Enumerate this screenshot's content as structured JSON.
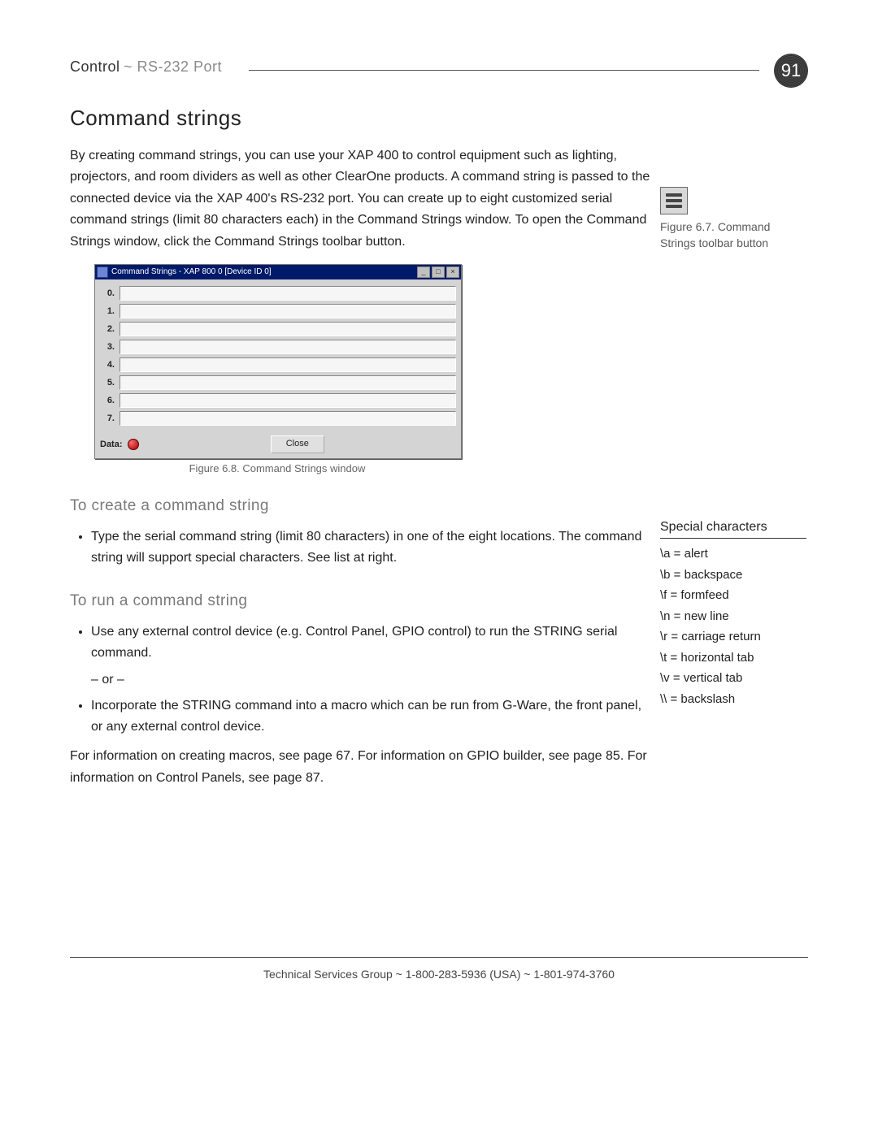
{
  "header": {
    "crumb1": "Control",
    "sep": "~",
    "crumb2": "RS-232 Port",
    "page_number": "91"
  },
  "main": {
    "h1": "Command strings",
    "intro": "By creating command strings, you can use your XAP 400 to control equipment such as lighting, projectors, and room dividers as well as other ClearOne products. A command string is passed to the connected device via the XAP 400's RS-232 port. You can create up to eight customized serial command strings (limit 80 characters each) in the Command Strings window. To open the Command Strings window, click the Command Strings toolbar button.",
    "fig68_caption": "Figure 6.8. Command Strings window",
    "h2_create": "To create a command string",
    "bullet_create": "Type the serial command string (limit 80 characters) in one of the eight locations. The command string will support special characters. See list at right.",
    "h2_run": "To run a command string",
    "bullet_run1": "Use any external control device (e.g. Control Panel, GPIO control) to run the STRING serial command.",
    "or_text": "– or –",
    "bullet_run2": "Incorporate the STRING command into a macro which can be run from G-Ware, the front panel, or any external control device.",
    "outro": "For information on creating macros, see page 67. For information on GPIO builder, see page 85. For information on Control Panels, see page 87."
  },
  "window": {
    "title": "Command Strings - XAP 800 0 [Device ID 0]",
    "rows": [
      "0.",
      "1.",
      "2.",
      "3.",
      "4.",
      "5.",
      "6.",
      "7."
    ],
    "data_label": "Data:",
    "close_label": "Close"
  },
  "side_fig67": {
    "caption": "Figure 6.7. Command Strings toolbar button"
  },
  "special_chars": {
    "heading": "Special characters",
    "rows": [
      "\\a =  alert",
      "\\b =  backspace",
      "\\f =  formfeed",
      "\\n =  new line",
      "\\r =  carriage return",
      "\\t =  horizontal tab",
      "\\v =  vertical tab",
      "\\\\ =  backslash"
    ]
  },
  "footer": {
    "text": "Technical Services Group ~  1-800-283-5936 (USA) ~  1-801-974-3760"
  }
}
